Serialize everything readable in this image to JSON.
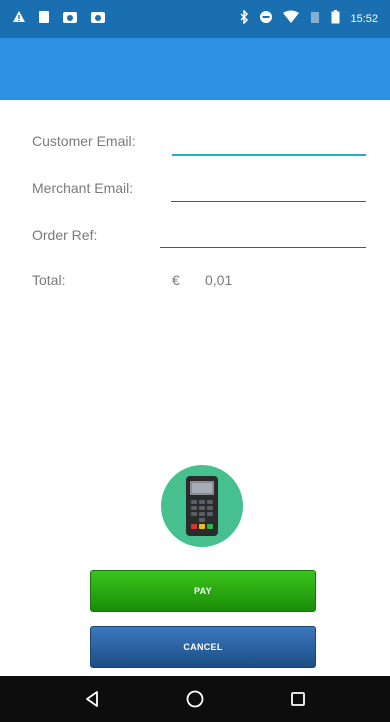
{
  "status_bar": {
    "time": "15:52",
    "left_icons": [
      "warning-icon",
      "image-icon",
      "photo-icon",
      "photo-icon"
    ],
    "right_icons": [
      "bluetooth-icon",
      "do-not-disturb-icon",
      "wifi-icon",
      "signal-icon",
      "battery-icon"
    ]
  },
  "colors": {
    "status_bar": "#1a6fb0",
    "app_bar": "#2e90e3",
    "accent_line": "#1fb0c8",
    "pay_button": "#25a612",
    "cancel_button": "#2a639e",
    "terminal_circle": "#46c08f"
  },
  "form": {
    "customer_email_label": "Customer Email:",
    "customer_email_value": "",
    "merchant_email_label": "Merchant Email:",
    "merchant_email_value": "",
    "order_ref_label": "Order Ref:",
    "order_ref_value": "",
    "total_label": "Total:",
    "currency_symbol": "€",
    "total_amount": "0,01"
  },
  "buttons": {
    "pay_label": "PAY",
    "cancel_label": "CANCEL"
  },
  "nav": {
    "icons": [
      "back-icon",
      "home-icon",
      "recents-icon"
    ]
  }
}
